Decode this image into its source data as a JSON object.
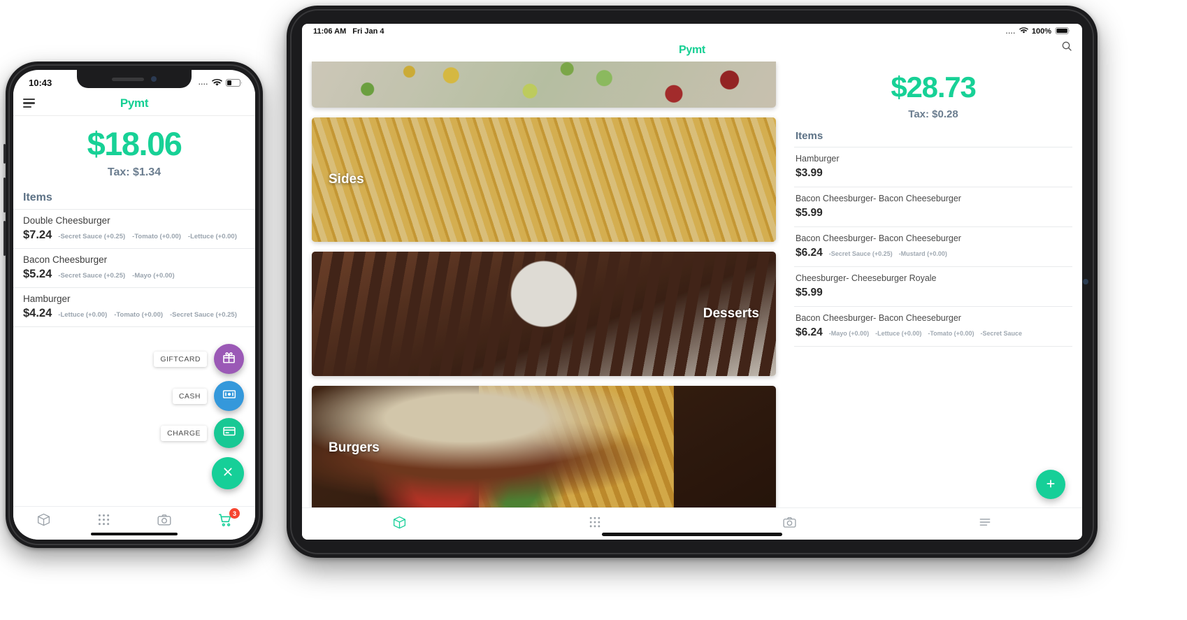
{
  "brand": "Pymt",
  "phone": {
    "status": {
      "time": "10:43",
      "signal_dots": "....",
      "wifi": "wifi-icon",
      "battery": "battery-icon"
    },
    "menu_icon": "hamburger-menu-icon",
    "total": "$18.06",
    "tax": "Tax: $1.34",
    "items_header": "Items",
    "items": [
      {
        "name": "Double Cheesburger",
        "price": "$7.24",
        "mods": [
          "-Secret Sauce (+0.25)",
          "-Tomato (+0.00)",
          "-Lettuce (+0.00)"
        ]
      },
      {
        "name": "Bacon Cheesburger",
        "price": "$5.24",
        "mods": [
          "-Secret Sauce (+0.25)",
          "-Mayo (+0.00)"
        ]
      },
      {
        "name": "Hamburger",
        "price": "$4.24",
        "mods": [
          "-Lettuce (+0.00)",
          "-Tomato (+0.00)",
          "-Secret Sauce (+0.25)"
        ]
      }
    ],
    "fabs": [
      {
        "label": "GIFTCARD",
        "icon": "gift-icon",
        "color": "#9b59b6"
      },
      {
        "label": "CASH",
        "icon": "cash-icon",
        "color": "#3498db"
      },
      {
        "label": "CHARGE",
        "icon": "credit-card-icon",
        "color": "#18c894"
      }
    ],
    "fab_close": {
      "icon": "close-icon",
      "color": "#16cf98"
    },
    "tabs": [
      {
        "icon": "package-box-icon",
        "badge": ""
      },
      {
        "icon": "grid-dots-icon",
        "badge": ""
      },
      {
        "icon": "camera-icon",
        "badge": ""
      },
      {
        "icon": "shopping-cart-icon",
        "badge": "3"
      }
    ]
  },
  "tablet": {
    "status": {
      "time": "11:06 AM",
      "date": "Fri Jan 4",
      "signal_dots": "....",
      "wifi": "wifi-icon",
      "battery_pct": "100%"
    },
    "search_icon": "search-icon",
    "categories": [
      {
        "label": "",
        "image": "salad-photo",
        "align": "left"
      },
      {
        "label": "Sides",
        "image": "fries-photo",
        "align": "left"
      },
      {
        "label": "Desserts",
        "image": "brownie-dessert-photo",
        "align": "right"
      },
      {
        "label": "Burgers",
        "image": "burger-fries-photo",
        "align": "left"
      }
    ],
    "total": "$28.73",
    "tax": "Tax: $0.28",
    "items_header": "Items",
    "items": [
      {
        "name": "Hamburger",
        "price": "$3.99",
        "mods": []
      },
      {
        "name": "Bacon Cheesburger- Bacon Cheeseburger",
        "price": "$5.99",
        "mods": []
      },
      {
        "name": "Bacon Cheesburger- Bacon Cheeseburger",
        "price": "$6.24",
        "mods": [
          "-Secret Sauce (+0.25)",
          "-Mustard (+0.00)"
        ]
      },
      {
        "name": "Cheesburger- Cheeseburger Royale",
        "price": "$5.99",
        "mods": []
      },
      {
        "name": "Bacon Cheesburger- Bacon Cheeseburger",
        "price": "$6.24",
        "mods": [
          "-Mayo (+0.00)",
          "-Lettuce (+0.00)",
          "-Tomato (+0.00)",
          "-Secret Sauce"
        ]
      }
    ],
    "fab_add": {
      "icon": "plus-icon",
      "color": "#16cf98"
    },
    "tabs": [
      {
        "icon": "package-box-icon",
        "active": true
      },
      {
        "icon": "grid-dots-icon",
        "active": false
      },
      {
        "icon": "camera-icon",
        "active": false
      },
      {
        "icon": "list-menu-icon",
        "active": false
      }
    ]
  },
  "colors": {
    "accent": "#17d196",
    "muted": "#6b7d8f",
    "badge": "#f6452f"
  }
}
